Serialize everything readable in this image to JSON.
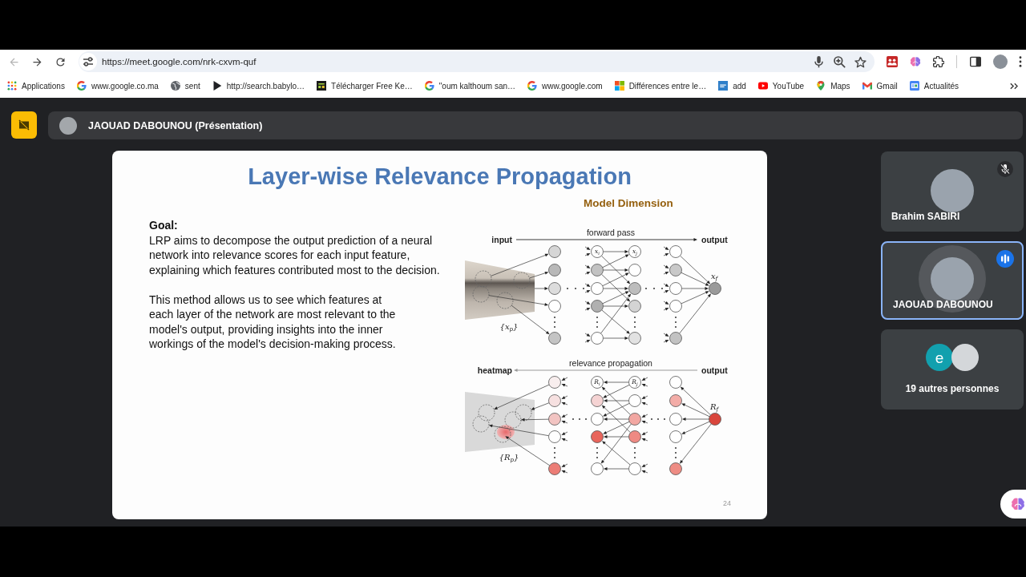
{
  "browser": {
    "nav_buttons": [
      {
        "kind": "back",
        "disabled": true
      },
      {
        "kind": "forward",
        "disabled": false
      },
      {
        "kind": "reload",
        "disabled": false
      }
    ],
    "url": "https://meet.google.com/nrk-cxvm-quf",
    "bookmarks": [
      {
        "kind": "apps",
        "label": "Applications"
      },
      {
        "kind": "google",
        "label": "www.google.co.ma"
      },
      {
        "kind": "globe",
        "label": "sent"
      },
      {
        "kind": "play",
        "label": "http://search.babylo…"
      },
      {
        "kind": "download",
        "label": "Télécharger Free Ke…"
      },
      {
        "kind": "google",
        "label": "\"oum kalthoum san…"
      },
      {
        "kind": "google",
        "label": "www.google.com"
      },
      {
        "kind": "windows",
        "label": "Différences entre le…"
      },
      {
        "kind": "tile",
        "label": "add"
      },
      {
        "kind": "youtube",
        "label": "YouTube"
      },
      {
        "kind": "maps",
        "label": "Maps"
      },
      {
        "kind": "gmail",
        "label": "Gmail"
      },
      {
        "kind": "news",
        "label": "Actualités"
      }
    ]
  },
  "meet": {
    "presenter_name": "JAOUAD DABOUNOU (Présentation)",
    "slide": {
      "title": "Layer-wise Relevance Propagation",
      "goal_heading": "Goal:",
      "goal_text": "LRP aims to decompose the output prediction of a neural network into relevance scores for each input feature, explaining which features contributed most to the decision.",
      "method_text": "This method allows us to see which features at each layer of the network are most relevant to the model's output, providing insights into the inner workings of the model's decision-making process.",
      "page_number": "24",
      "figure": {
        "title": "Model Dimension",
        "panels": [
          {
            "kind": "forward",
            "caption": "forward pass",
            "left_label": "input",
            "right_label": "output",
            "image_label": "{x$_{p}$}",
            "layers": [
              {
                "nodes": [
                  {
                    "color": "#d6d6d6"
                  },
                  {
                    "color": "#b8b8b8"
                  },
                  {
                    "color": "#dcdcdc"
                  },
                  {
                    "color": "#ffffff"
                  },
                  {
                    "color": "#c4c4c4"
                  }
                ]
              },
              {
                "nodes": [
                  {
                    "label": "x$_{i}$",
                    "color": "#ffffff"
                  },
                  {
                    "color": "#c2c2c2"
                  },
                  {
                    "color": "#ffffff"
                  },
                  {
                    "color": "#b0b0b0"
                  },
                  {
                    "color": "#ffffff"
                  }
                ]
              },
              {
                "nodes": [
                  {
                    "label": "x$_{j}$",
                    "color": "#ffffff"
                  },
                  {
                    "color": "#ffffff"
                  },
                  {
                    "color": "#bdbdbd"
                  },
                  {
                    "color": "#d4d4d4"
                  },
                  {
                    "color": "#e2e2e2"
                  }
                ]
              },
              {
                "nodes": [
                  {
                    "color": "#ffffff"
                  },
                  {
                    "color": "#c8c8c8"
                  },
                  {
                    "color": "#ffffff"
                  },
                  {
                    "color": "#ffffff"
                  },
                  {
                    "color": "#c2c2c2"
                  }
                ]
              }
            ],
            "output_node": {
              "label": "x$_{f}$",
              "color": "#9a9a9a"
            }
          },
          {
            "kind": "backward",
            "caption": "relevance propagation",
            "left_label": "heatmap",
            "right_label": "output",
            "image_label": "{R$_{p}$}",
            "layers": [
              {
                "nodes": [
                  {
                    "color": "#f8eeee"
                  },
                  {
                    "color": "#f6e0e0"
                  },
                  {
                    "color": "#f2c4c2"
                  },
                  {
                    "color": "#ffffff"
                  },
                  {
                    "color": "#ec7d76"
                  }
                ]
              },
              {
                "nodes": [
                  {
                    "label": "R$_{i}$",
                    "color": "#ffffff"
                  },
                  {
                    "color": "#f5d3d3"
                  },
                  {
                    "color": "#ffffff"
                  },
                  {
                    "color": "#e8655c"
                  },
                  {
                    "color": "#ffffff"
                  }
                ]
              },
              {
                "nodes": [
                  {
                    "label": "R$_{j}$",
                    "color": "#ffffff"
                  },
                  {
                    "color": "#ffffff"
                  },
                  {
                    "color": "#f2a7a2"
                  },
                  {
                    "color": "#ee8a83"
                  },
                  {
                    "color": "#ffffff"
                  }
                ]
              },
              {
                "nodes": [
                  {
                    "color": "#ffffff"
                  },
                  {
                    "color": "#f3aca7"
                  },
                  {
                    "color": "#ffffff"
                  },
                  {
                    "color": "#ffffff"
                  },
                  {
                    "color": "#ee8c84"
                  }
                ]
              }
            ],
            "output_node": {
              "label": "R$_{f}$",
              "color": "#d9463c"
            }
          }
        ]
      }
    },
    "participants": [
      {
        "kind": "person",
        "name": "Brahim SABIRI",
        "muted": true,
        "speaking": false
      },
      {
        "kind": "person",
        "name": "JAOUAD DABOUNOU",
        "muted": false,
        "speaking": true
      },
      {
        "kind": "group",
        "label": "19 autres personnes",
        "avatars": [
          {
            "kind": "letter",
            "letter": "e",
            "color": "#12a0ae"
          },
          {
            "kind": "photo"
          }
        ]
      }
    ]
  }
}
